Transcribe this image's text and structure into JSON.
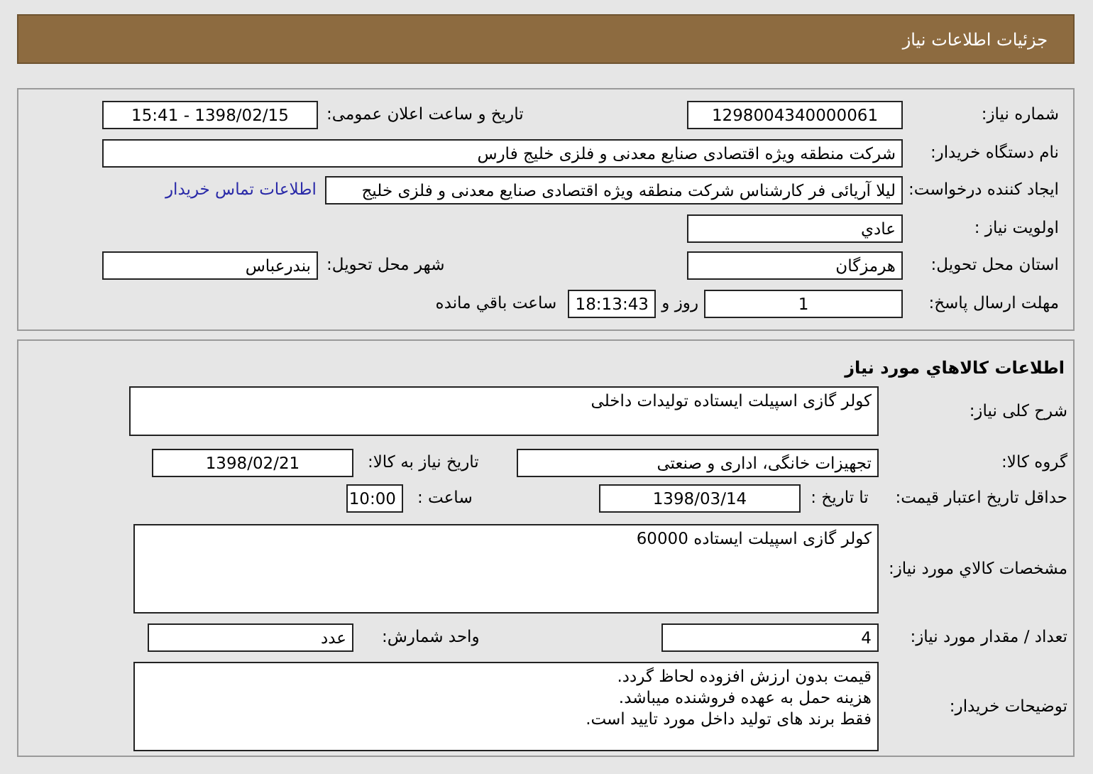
{
  "page_title": "جزئیات اطلاعات نیاز",
  "need_info": {
    "need_number": {
      "label": "شماره نیاز:",
      "value": "1298004340000061"
    },
    "announce": {
      "label": "تاریخ و ساعت اعلان عمومی:",
      "value": "1398/02/15 - 15:41"
    },
    "buyer": {
      "label": "نام دستگاه خریدار:",
      "value": "شرکت منطقه ویژه اقتصادی صنایع معدنی و فلزی خلیج فارس"
    },
    "requester": {
      "label": "ایجاد کننده درخواست:",
      "value": "لیلا آریائی فر کارشناس شرکت منطقه ویژه اقتصادی صنایع معدنی و فلزی خلیج",
      "link": "اطلاعات تماس خریدار"
    },
    "priority": {
      "label": "اولویت نیاز :",
      "value": "عادي"
    },
    "province": {
      "label": "استان محل تحویل:",
      "value": "هرمزگان"
    },
    "city": {
      "label": "شهر محل تحویل:",
      "value": "بندرعباس"
    },
    "deadline": {
      "label": "مهلت ارسال پاسخ:",
      "days": "1",
      "days_text": "روز و",
      "time": "18:13:43",
      "time_text": "ساعت باقي مانده"
    }
  },
  "goods": {
    "title": "اطلاعات كالاهاي مورد نياز",
    "summary": {
      "label": "شرح کلی نیاز:",
      "value": "کولر گازی اسپیلت ایستاده تولیدات داخلی"
    },
    "group": {
      "label": "گروه کالا:",
      "value": "تجهیزات خانگی، اداری و صنعتی"
    },
    "need_date": {
      "label": "تاریخ نیاز به کالا:",
      "value": "1398/02/21"
    },
    "price_validity": {
      "label": "حداقل تاریخ اعتبار قیمت:",
      "date_label": "تا تاریخ :",
      "date": "1398/03/14",
      "time_label": "ساعت :",
      "time": "10:00"
    },
    "specs": {
      "label": "مشخصات کالاي مورد نیاز:",
      "value": "کولر گازی اسپیلت ایستاده 60000"
    },
    "quantity": {
      "label": "تعداد / مقدار مورد نیاز:",
      "value": "4"
    },
    "unit": {
      "label": "واحد شمارش:",
      "value": "عدد"
    },
    "notes": {
      "label": "توضیحات خریدار:",
      "lines": [
        "قیمت بدون ارزش افزوده لحاظ گردد.",
        "هزینه حمل به عهده فروشنده میباشد.",
        "فقط برند های تولید داخل مورد تایید است."
      ]
    }
  }
}
